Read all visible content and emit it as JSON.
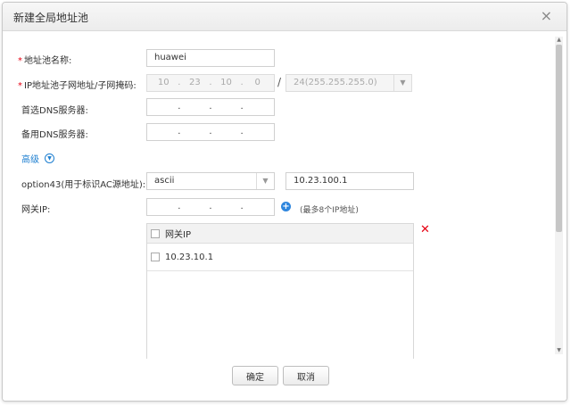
{
  "dialog": {
    "title": "新建全局地址池",
    "close_glyph": "×"
  },
  "form": {
    "pool_name": {
      "label": "地址池名称:",
      "required_mark": "*",
      "value": "huawei"
    },
    "subnet": {
      "label": "IP地址池子网地址/子网掩码:",
      "required_mark": "*",
      "octets": [
        "10",
        "23",
        "10",
        "0"
      ],
      "separator": "/",
      "mask_value": "24(255.255.255.0)"
    },
    "dns_primary": {
      "label": "首选DNS服务器:"
    },
    "dns_secondary": {
      "label": "备用DNS服务器:"
    },
    "advanced": {
      "label": "高级",
      "icon": "chevron-down-circle-icon"
    },
    "option43": {
      "label": "option43(用于标识AC源地址):",
      "type_value": "ascii",
      "value": "10.23.100.1"
    },
    "gateway": {
      "label": "网关IP:",
      "hint": "(最多8个IP地址)",
      "table": {
        "header": "网关IP",
        "rows": [
          "10.23.10.1"
        ]
      }
    }
  },
  "footer": {
    "ok_label": "确定",
    "cancel_label": "取消"
  },
  "colors": {
    "required": "#e60012",
    "link": "#1e7fd0",
    "delete": "#e60012",
    "add": "#2e86de"
  }
}
